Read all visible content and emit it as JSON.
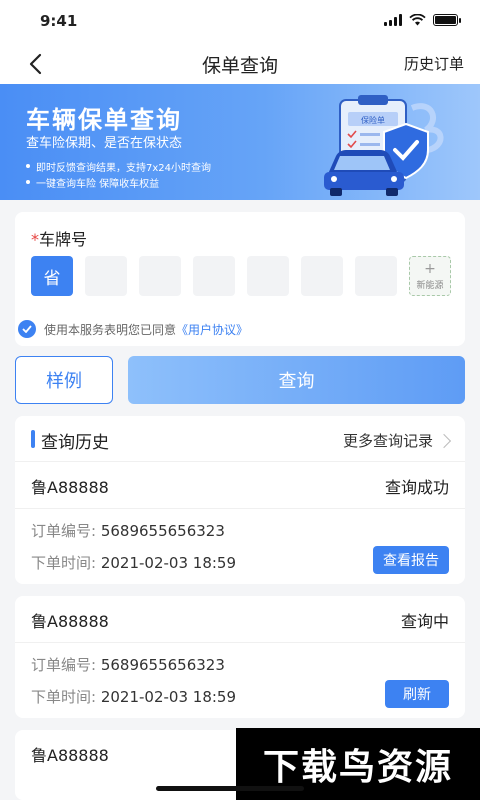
{
  "status": {
    "time": "9:41"
  },
  "nav": {
    "title": "保单查询",
    "right": "历史订单"
  },
  "banner": {
    "title": "车辆保单查询",
    "subtitle": "查车险保期、是否在保状态",
    "bullets": [
      "即时反馈查询结果，支持7x24小时查询",
      "一键查询车险 保障收车权益"
    ],
    "doc_label": "保险单"
  },
  "plate": {
    "required_mark": "*",
    "label": "车牌号",
    "province_btn": "省",
    "new_energy_plus": "+",
    "new_energy_label": "新能源"
  },
  "agreement": {
    "text": "使用本服务表明您已同意",
    "link": "《用户协议》"
  },
  "buttons": {
    "sample": "样例",
    "query": "查询"
  },
  "history": {
    "title": "查询历史",
    "more": "更多查询记录",
    "records": [
      {
        "plate": "鲁A88888",
        "status": "查询成功",
        "order_label": "订单编号: ",
        "order_no": "5689655656323",
        "time_label": "下单时间: ",
        "time": "2021-02-03 18:59",
        "action": "查看报告"
      },
      {
        "plate": "鲁A88888",
        "status": "查询中",
        "order_label": "订单编号: ",
        "order_no": "5689655656323",
        "time_label": "下单时间: ",
        "time": "2021-02-03 18:59",
        "action": "刷新"
      },
      {
        "plate": "鲁A88888"
      }
    ]
  },
  "watermark": "下载鸟资源",
  "colors": {
    "accent": "#3d82f2",
    "required": "#e64340"
  }
}
